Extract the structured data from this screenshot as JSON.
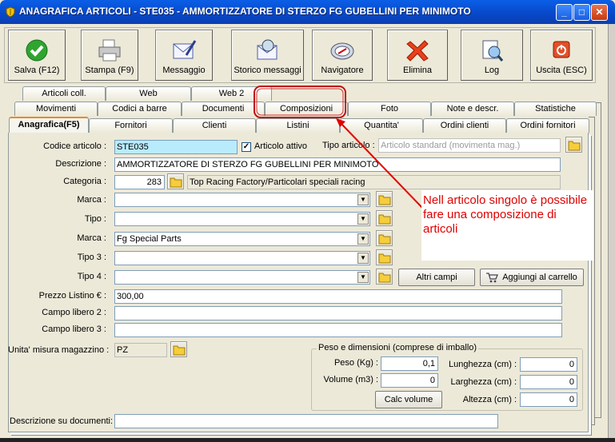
{
  "window": {
    "title": "ANAGRAFICA ARTICOLI - STE035 - AMMORTIZZATORE DI STERZO FG GUBELLINI PER MINIMOTO",
    "minimize": "_",
    "maximize": "□",
    "close": "✕"
  },
  "toolbar": {
    "buttons": [
      {
        "label": "Salva (F12)",
        "icon": "check-icon"
      },
      {
        "label": "Stampa (F9)",
        "icon": "printer-icon"
      },
      {
        "label": "Messaggio",
        "icon": "envelope-pen-icon"
      },
      {
        "label": "Storico messaggi",
        "icon": "envelope-search-icon"
      },
      {
        "label": "Navigatore",
        "icon": "compass-icon"
      },
      {
        "label": "Elimina",
        "icon": "red-x-icon"
      },
      {
        "label": "Log",
        "icon": "log-search-icon"
      },
      {
        "label": "Uscita (ESC)",
        "icon": "power-icon"
      }
    ]
  },
  "tabs": {
    "row1": [
      "Articoli coll.",
      "Web",
      "Web 2"
    ],
    "row2": [
      "Movimenti",
      "Codici a barre",
      "Documenti",
      "Composizioni",
      "Foto",
      "Note e descr.",
      "Statistiche"
    ],
    "row3": [
      "Anagrafica(F5)",
      "Fornitori",
      "Clienti",
      "Listini",
      "Quantita'",
      "Ordini clienti",
      "Ordini fornitori"
    ]
  },
  "form": {
    "codice_label": "Codice articolo :",
    "codice_value": "STE035",
    "attivo_label": "Articolo attivo",
    "attivo_check": "✓",
    "tipo_articolo_label": "Tipo articolo :",
    "tipo_articolo_value": "Articolo standard (movimenta mag.)",
    "descrizione_label": "Descrizione :",
    "descrizione_value": "AMMORTIZZATORE DI STERZO FG GUBELLINI PER MINIMOTO",
    "categoria_label": "Categoria :",
    "categoria_code": "283",
    "categoria_desc": "Top Racing Factory/Particolari speciali racing",
    "marca1_label": "Marca :",
    "marca1_value": "",
    "tipo_label": "Tipo :",
    "tipo_value": "",
    "marca2_label": "Marca :",
    "marca2_value": "Fg Special Parts",
    "tipo3_label": "Tipo 3 :",
    "tipo3_value": "",
    "tipo4_label": "Tipo 4 :",
    "tipo4_value": "",
    "altri_campi": "Altri campi",
    "aggiungi_carrello": "Aggiungi al carrello",
    "prezzo_label": "Prezzo Listino € :",
    "prezzo_value": "300,00",
    "campo2_label": "Campo libero 2 :",
    "campo2_value": "",
    "campo3_label": "Campo libero 3 :",
    "campo3_value": "",
    "um_label": "Unita' misura magazzino :",
    "um_value": "PZ",
    "peso_group_title": "Peso e dimensioni (comprese di imballo)",
    "peso_label": "Peso (Kg) :",
    "peso_value": "0,1",
    "volume_label": "Volume (m3) :",
    "volume_value": "0",
    "lunghezza_label": "Lunghezza (cm) :",
    "lunghezza_value": "0",
    "larghezza_label": "Larghezza (cm) :",
    "larghezza_value": "0",
    "altezza_label": "Altezza (cm) :",
    "altezza_value": "0",
    "calc_volume": "Calc volume",
    "descr_doc_label": "Descrizione su documenti:",
    "descr_doc_value": ""
  },
  "annotation": {
    "text": "Nell articolo singolo è possibile fare una composizione di articoli",
    "color": "#e00000"
  }
}
